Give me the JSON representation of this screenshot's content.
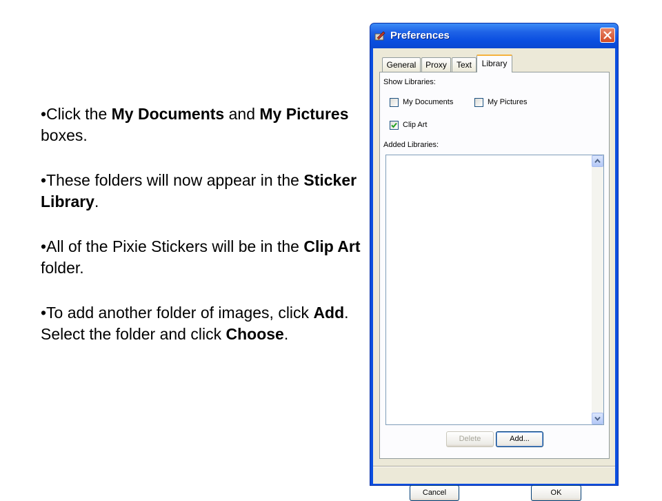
{
  "slide": {
    "bullets": [
      {
        "parts": [
          "•Click the ",
          "My Documents",
          " and ",
          "My Pictures",
          " boxes."
        ]
      },
      {
        "parts": [
          "•These folders will now appear in the ",
          "Sticker Library",
          "."
        ]
      },
      {
        "parts": [
          "•All of the Pixie Stickers will be in the ",
          "Clip Art",
          " folder."
        ]
      },
      {
        "parts": [
          "•To add another folder of images, click ",
          "Add",
          ". Select the folder and click ",
          "Choose",
          "."
        ]
      }
    ]
  },
  "window": {
    "title": "Preferences",
    "icons": {
      "app": "preferences-app-icon",
      "close": "close-icon"
    },
    "tabs": [
      "General",
      "Proxy",
      "Text",
      "Library"
    ],
    "active_tab": "Library",
    "show_libraries_label": "Show Libraries:",
    "checkboxes": [
      {
        "label": "My Documents",
        "checked": false
      },
      {
        "label": "My Pictures",
        "checked": false
      },
      {
        "label": "Clip Art",
        "checked": true
      }
    ],
    "added_libraries_label": "Added Libraries:",
    "list_buttons": {
      "delete": "Delete",
      "add": "Add..."
    },
    "dialog_buttons": {
      "cancel": "Cancel",
      "ok": "OK"
    }
  }
}
